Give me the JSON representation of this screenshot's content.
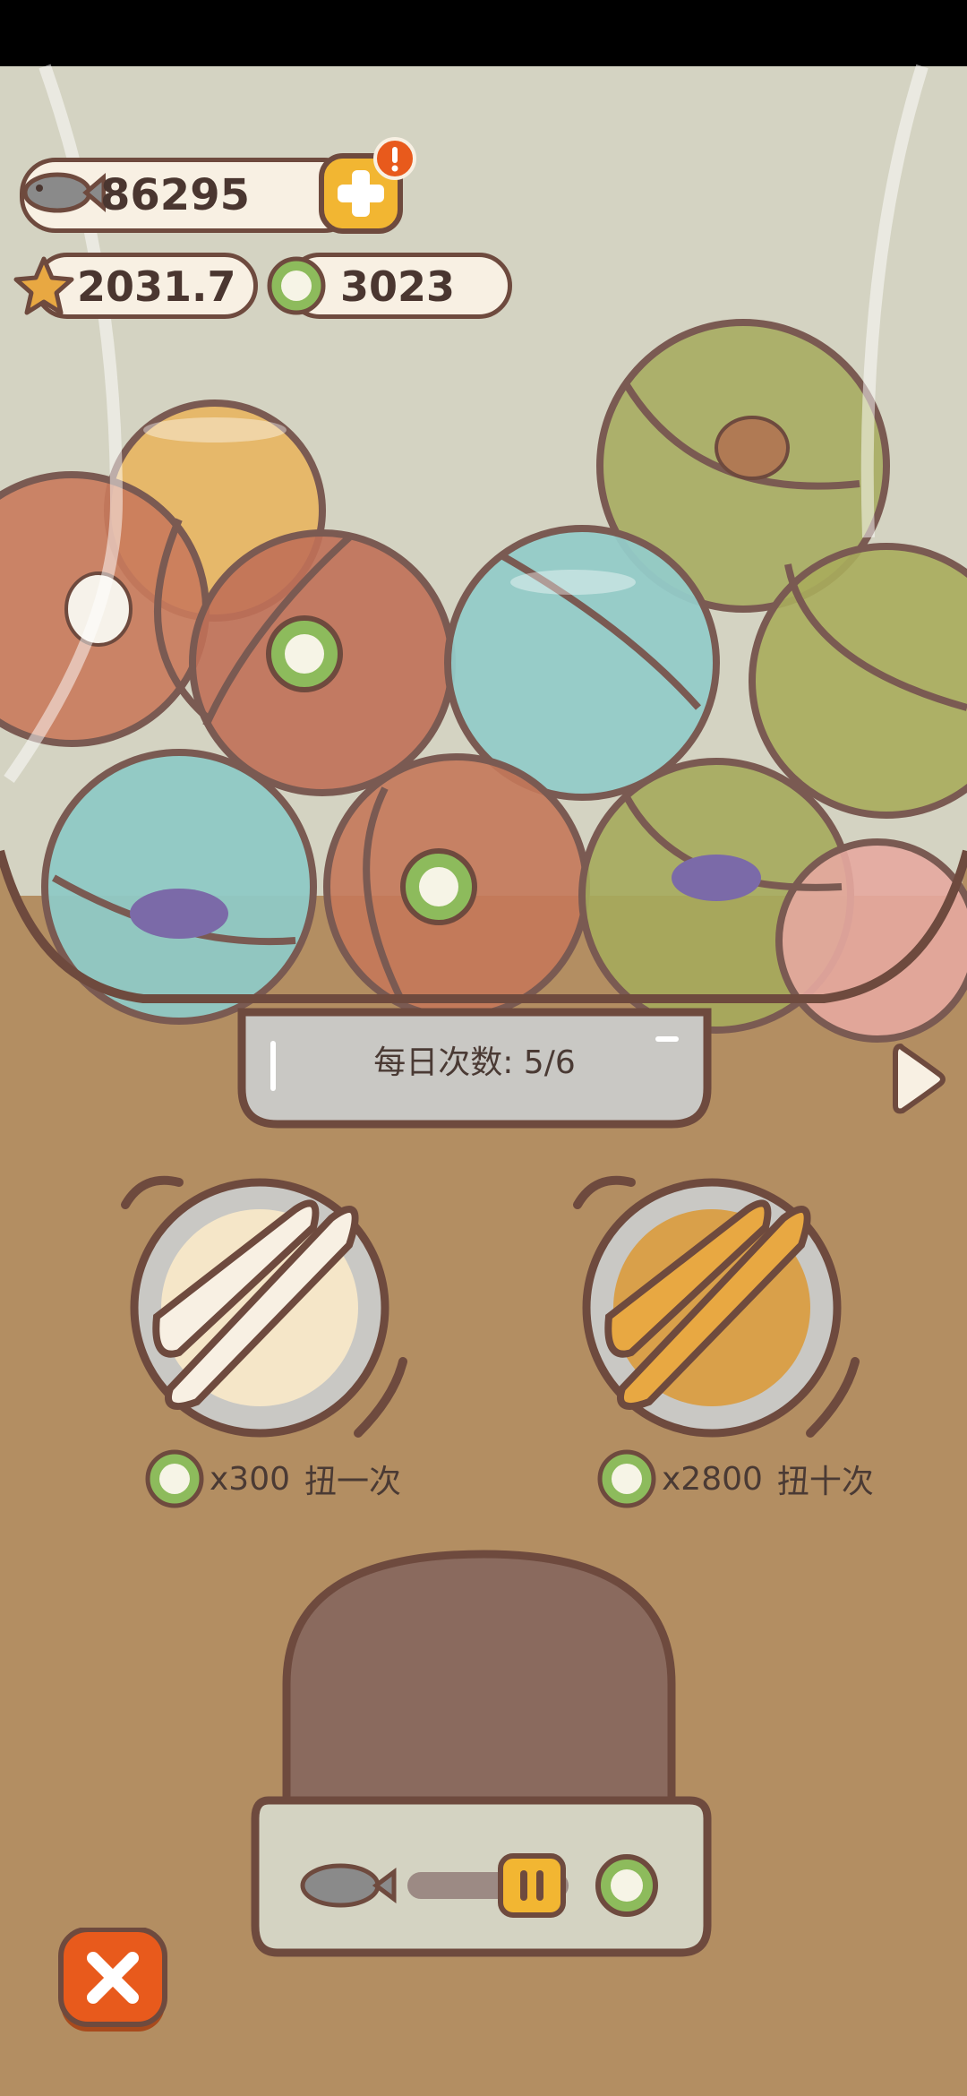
{
  "currency": {
    "fish": {
      "value": "86295",
      "icon": "fish-icon"
    },
    "stars": {
      "value": "2031.7",
      "icon": "star-icon"
    },
    "coins": {
      "value": "3023",
      "icon": "kiwi-coin-icon"
    },
    "add_icon": "plus-icon",
    "alert_icon": "exclamation-icon"
  },
  "machine": {
    "daily_label": "每日次数: 5/6",
    "single_pull": {
      "cost_multiplier": "x300",
      "label": "扭一次"
    },
    "ten_pull": {
      "cost_multiplier": "x2800",
      "label": "扭十次"
    }
  },
  "colors": {
    "background": "#b38e62",
    "jar": "#d4d3c2",
    "outline": "#6e4a3e",
    "accent_orange": "#e85a1c",
    "gold": "#f2b632"
  }
}
